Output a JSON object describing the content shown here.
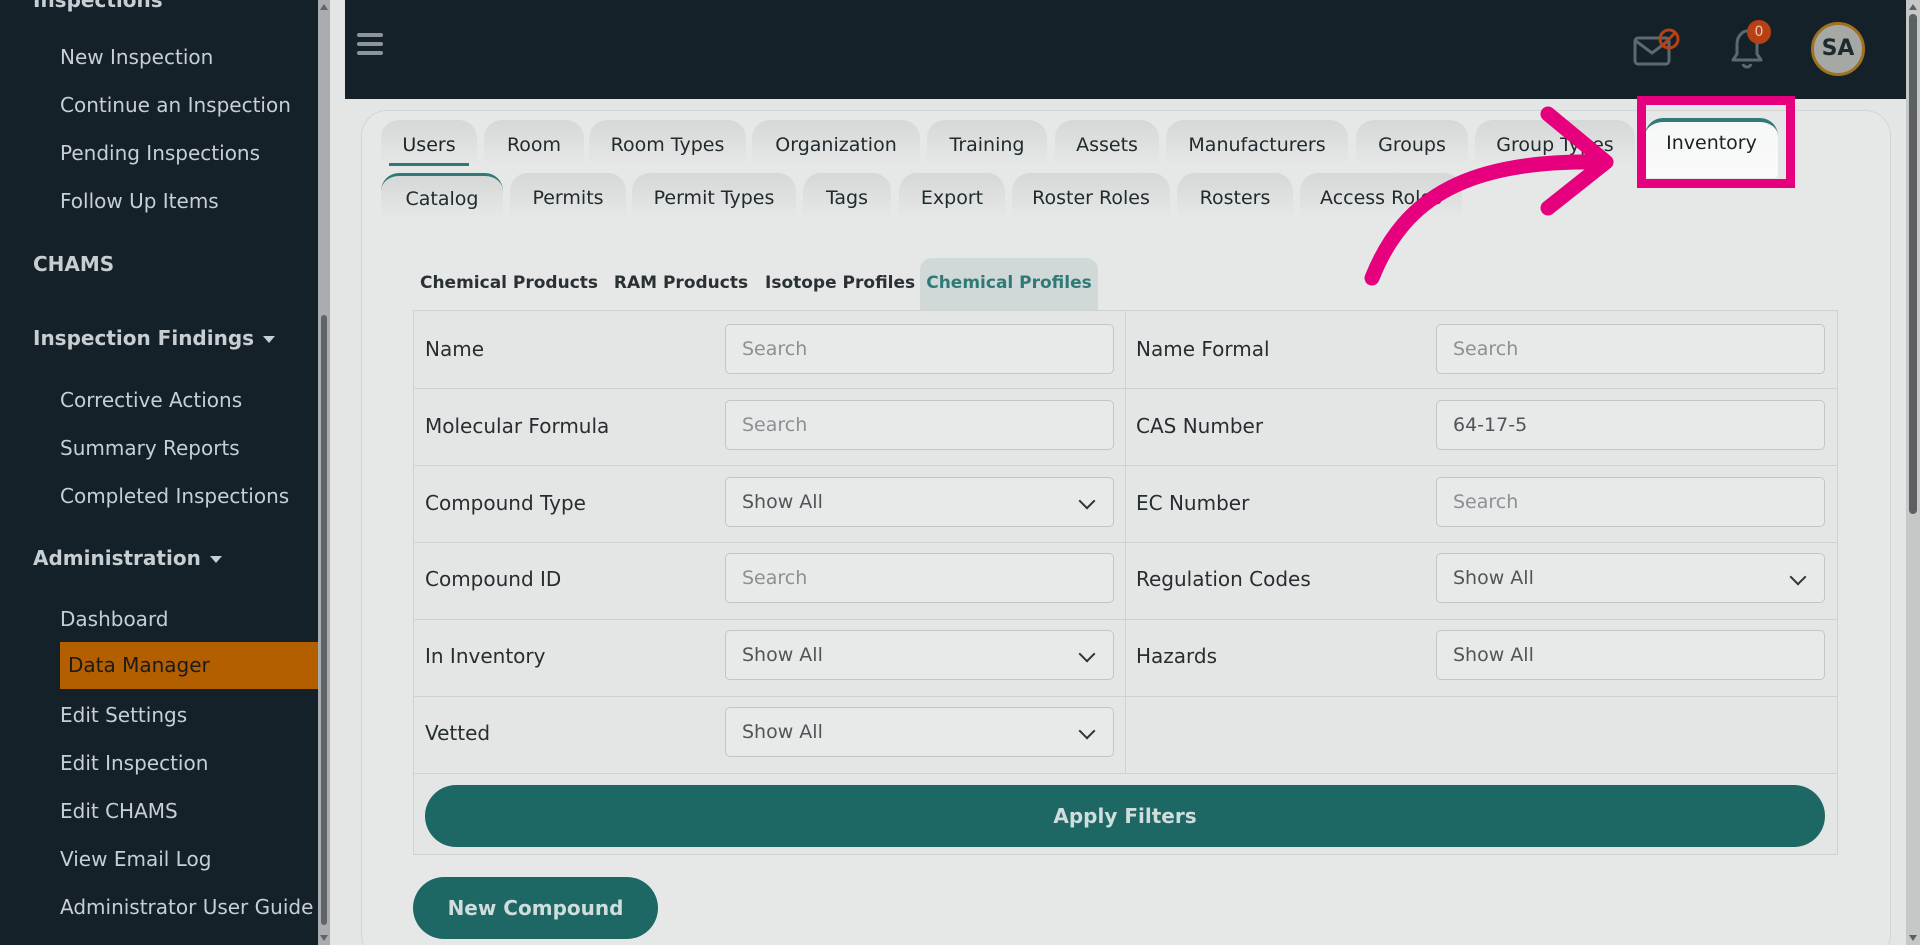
{
  "sidebar": {
    "top_section": "Inspections",
    "inspection_items": [
      "New Inspection",
      "Continue an Inspection",
      "Pending Inspections",
      "Follow Up Items"
    ],
    "chams": "CHAMS",
    "findings_section": "Inspection Findings",
    "findings_items": [
      "Corrective Actions",
      "Summary Reports",
      "Completed Inspections"
    ],
    "admin_section": "Administration",
    "admin_items": [
      "Dashboard",
      "Data Manager",
      "Edit Settings",
      "Edit Inspection",
      "Edit CHAMS",
      "View Email Log",
      "Administrator User Guide"
    ],
    "active_item": "Data Manager"
  },
  "topbar": {
    "notification_count": "0",
    "avatar_initials": "SA"
  },
  "tabs_row1": [
    "Users",
    "Room",
    "Room Types",
    "Organization",
    "Training",
    "Assets",
    "Manufacturers",
    "Groups",
    "Group Types",
    "Inventory"
  ],
  "tabs_row2": [
    "Catalog",
    "Permits",
    "Permit Types",
    "Tags",
    "Export",
    "Roster Roles",
    "Rosters",
    "Access Roles"
  ],
  "subtabs": [
    "Chemical Products",
    "RAM Products",
    "Isotope Profiles",
    "Chemical Profiles"
  ],
  "active_subtab": "Chemical Profiles",
  "filters": {
    "name": {
      "label": "Name",
      "placeholder": "Search"
    },
    "name_formal": {
      "label": "Name Formal",
      "placeholder": "Search"
    },
    "molecular_formula": {
      "label": "Molecular Formula",
      "placeholder": "Search"
    },
    "cas_number": {
      "label": "CAS Number",
      "value": "64-17-5"
    },
    "compound_type": {
      "label": "Compound Type",
      "value": "Show All"
    },
    "ec_number": {
      "label": "EC Number",
      "placeholder": "Search"
    },
    "compound_id": {
      "label": "Compound ID",
      "placeholder": "Search"
    },
    "regulation_codes": {
      "label": "Regulation Codes",
      "value": "Show All"
    },
    "in_inventory": {
      "label": "In Inventory",
      "value": "Show All"
    },
    "hazards": {
      "label": "Hazards",
      "value": "Show All"
    },
    "vetted": {
      "label": "Vetted",
      "value": "Show All"
    }
  },
  "buttons": {
    "apply_filters": "Apply Filters",
    "new_compound": "New Compound"
  },
  "colors": {
    "sidebar_bg": "#142128",
    "active_item": "#b35f00",
    "teal": "#1d6765",
    "highlight": "#e6007e"
  }
}
